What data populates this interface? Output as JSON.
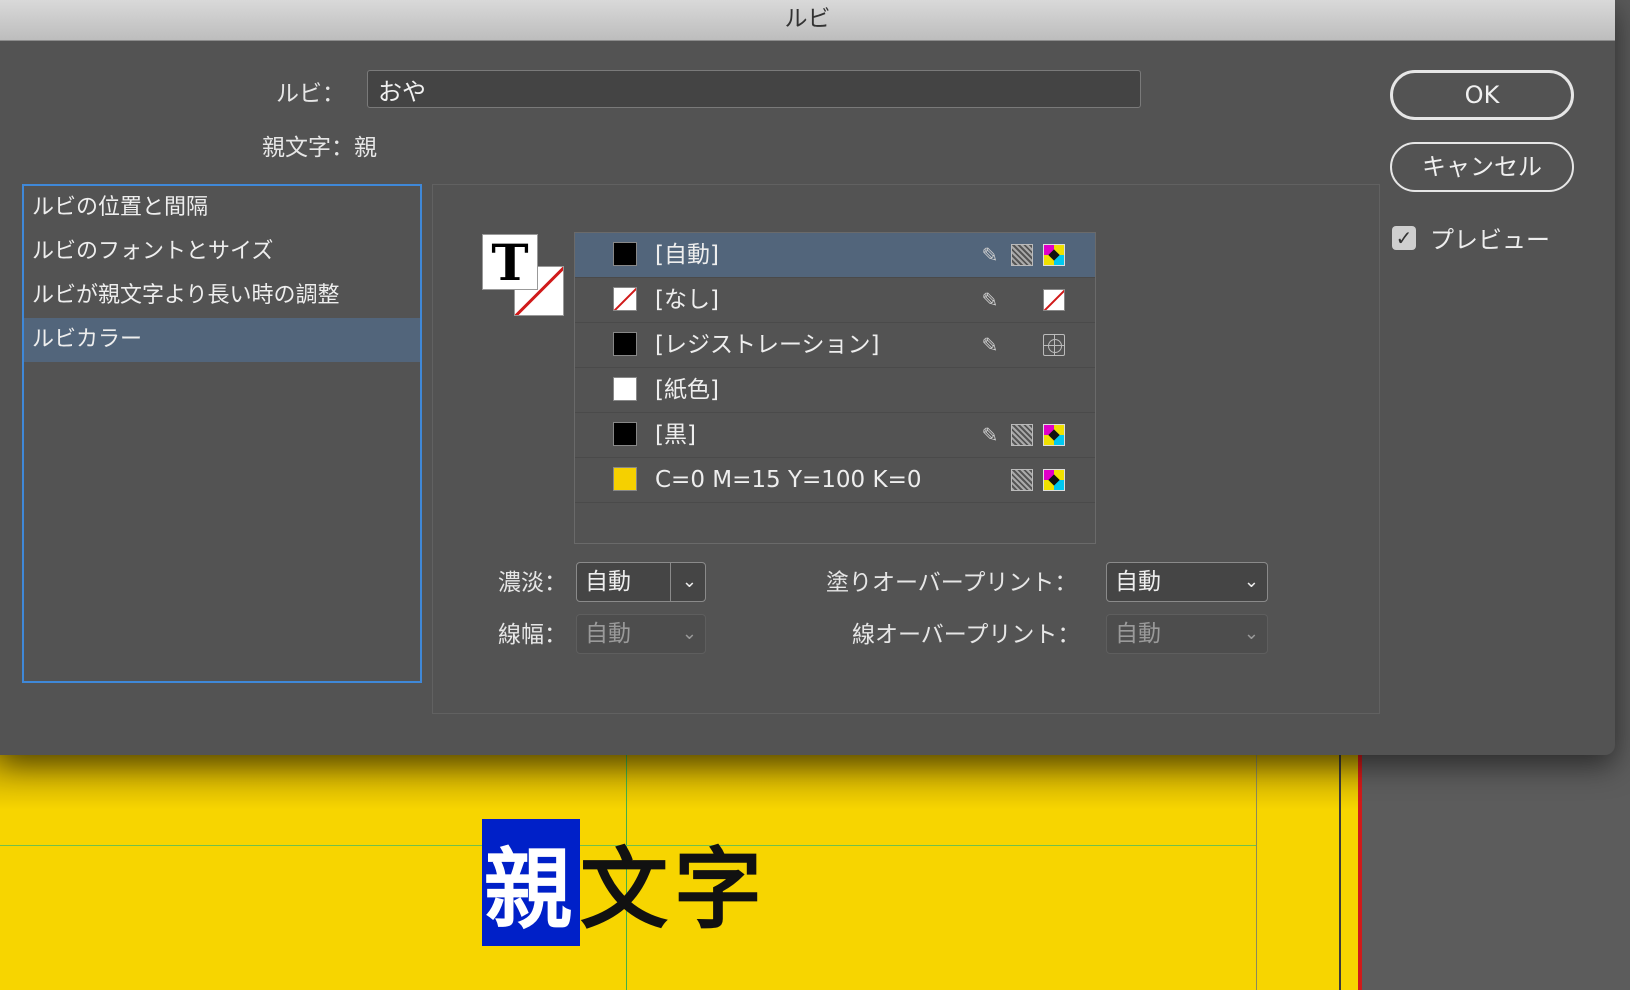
{
  "window": {
    "title": "ルビ"
  },
  "ruby": {
    "label": "ルビ：",
    "value": "おや"
  },
  "base_text": {
    "label": "親文字：親"
  },
  "categories": [
    {
      "label": "ルビの位置と間隔"
    },
    {
      "label": "ルビのフォントとサイズ"
    },
    {
      "label": "ルビが親文字より長い時の調整"
    },
    {
      "label": "ルビカラー",
      "selected": true
    }
  ],
  "fill_stroke_icon": {
    "front_glyph": "T"
  },
  "swatches": [
    {
      "name": "[自動]",
      "color": "#000000",
      "icons": [
        "pen",
        "tint",
        "cmyk"
      ],
      "selected": true
    },
    {
      "name": "[なし]",
      "color": "none",
      "icons": [
        "pen",
        "none"
      ]
    },
    {
      "name": "[レジストレーション]",
      "color": "#000000",
      "icons": [
        "pen",
        "registration"
      ]
    },
    {
      "name": "[紙色]",
      "color": "#ffffff",
      "icons": []
    },
    {
      "name": "[黒]",
      "color": "#000000",
      "icons": [
        "pen",
        "tint",
        "cmyk"
      ]
    },
    {
      "name": "C=0 M=15 Y=100 K=0",
      "color": "#f5d000",
      "icons": [
        "tint",
        "cmyk"
      ]
    }
  ],
  "tint": {
    "label": "濃淡：",
    "value": "自動"
  },
  "stroke_weight": {
    "label": "線幅：",
    "value": "自動",
    "disabled": true
  },
  "fill_overprint": {
    "label": "塗りオーバープリント：",
    "value": "自動"
  },
  "stroke_overprint": {
    "label": "線オーバープリント：",
    "value": "自動",
    "disabled": true
  },
  "buttons": {
    "ok": "OK",
    "cancel": "キャンセル"
  },
  "preview": {
    "label": "プレビュー",
    "checked": true
  },
  "document": {
    "selected_char": "親",
    "rest_text": "文字"
  },
  "colors": {
    "selection": "#52657b",
    "focus": "#3f88d8",
    "page": "#f7d500",
    "text_highlight": "#0020c8"
  }
}
